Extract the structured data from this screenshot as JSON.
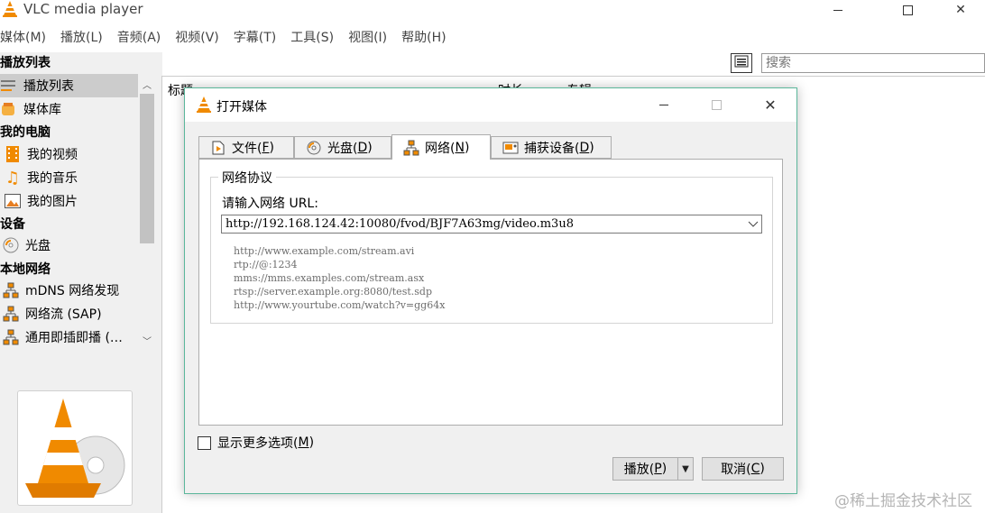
{
  "window": {
    "title": "VLC media player",
    "menu": [
      "媒体(M)",
      "播放(L)",
      "音频(A)",
      "视频(V)",
      "字幕(T)",
      "工具(S)",
      "视图(I)",
      "帮助(H)"
    ]
  },
  "sidebar": {
    "title": "播放列表",
    "items": [
      {
        "kind": "item",
        "label": "播放列表",
        "icon": "playlist-icon",
        "selected": true
      },
      {
        "kind": "item",
        "label": "媒体库",
        "icon": "library-icon"
      },
      {
        "kind": "header",
        "label": "我的电脑"
      },
      {
        "kind": "item",
        "label": "我的视频",
        "icon": "film-icon"
      },
      {
        "kind": "item",
        "label": "我的音乐",
        "icon": "music-note-icon"
      },
      {
        "kind": "item",
        "label": "我的图片",
        "icon": "picture-icon"
      },
      {
        "kind": "header",
        "label": "设备"
      },
      {
        "kind": "item",
        "label": "光盘",
        "icon": "disc-icon"
      },
      {
        "kind": "header",
        "label": "本地网络"
      },
      {
        "kind": "item",
        "label": "mDNS 网络发现",
        "icon": "network-icon"
      },
      {
        "kind": "item",
        "label": "网络流 (SAP)",
        "icon": "network-icon"
      },
      {
        "kind": "item",
        "label": "通用即插即播 (…",
        "icon": "network-icon"
      }
    ]
  },
  "playlist": {
    "search_placeholder": "搜索",
    "columns": [
      "标题",
      "时长",
      "专辑"
    ]
  },
  "dialog": {
    "title": "打开媒体",
    "tabs": [
      {
        "label": "文件(",
        "key": "F",
        "icon": "file-icon"
      },
      {
        "label": "光盘(",
        "key": "D",
        "icon": "disc-icon"
      },
      {
        "label": "网络(",
        "key": "N",
        "icon": "network-icon",
        "active": true
      },
      {
        "label": "捕获设备(",
        "key": "D",
        "icon": "capture-device-icon"
      }
    ],
    "group_title": "网络协议",
    "url_label": "请输入网络 URL:",
    "url_value": "http://192.168.124.42:10080/fvod/BJF7A63mg/video.m3u8",
    "examples": [
      "http://www.example.com/stream.avi",
      "rtp://@:1234",
      "mms://mms.examples.com/stream.asx",
      "rtsp://server.example.org:8080/test.sdp",
      "http://www.yourtube.com/watch?v=gg64x"
    ],
    "more_options": {
      "label": "显示更多选项(",
      "key": "M",
      "checked": false
    },
    "play_button": {
      "label": "播放(",
      "key": "P"
    },
    "cancel_button": {
      "label": "取消(",
      "key": "C"
    }
  },
  "watermark": "@稀土掘金技术社区",
  "colors": {
    "vlc_orange": "#f08a00",
    "dialog_border": "#5bb79b",
    "selected_row": "#cccccc"
  }
}
